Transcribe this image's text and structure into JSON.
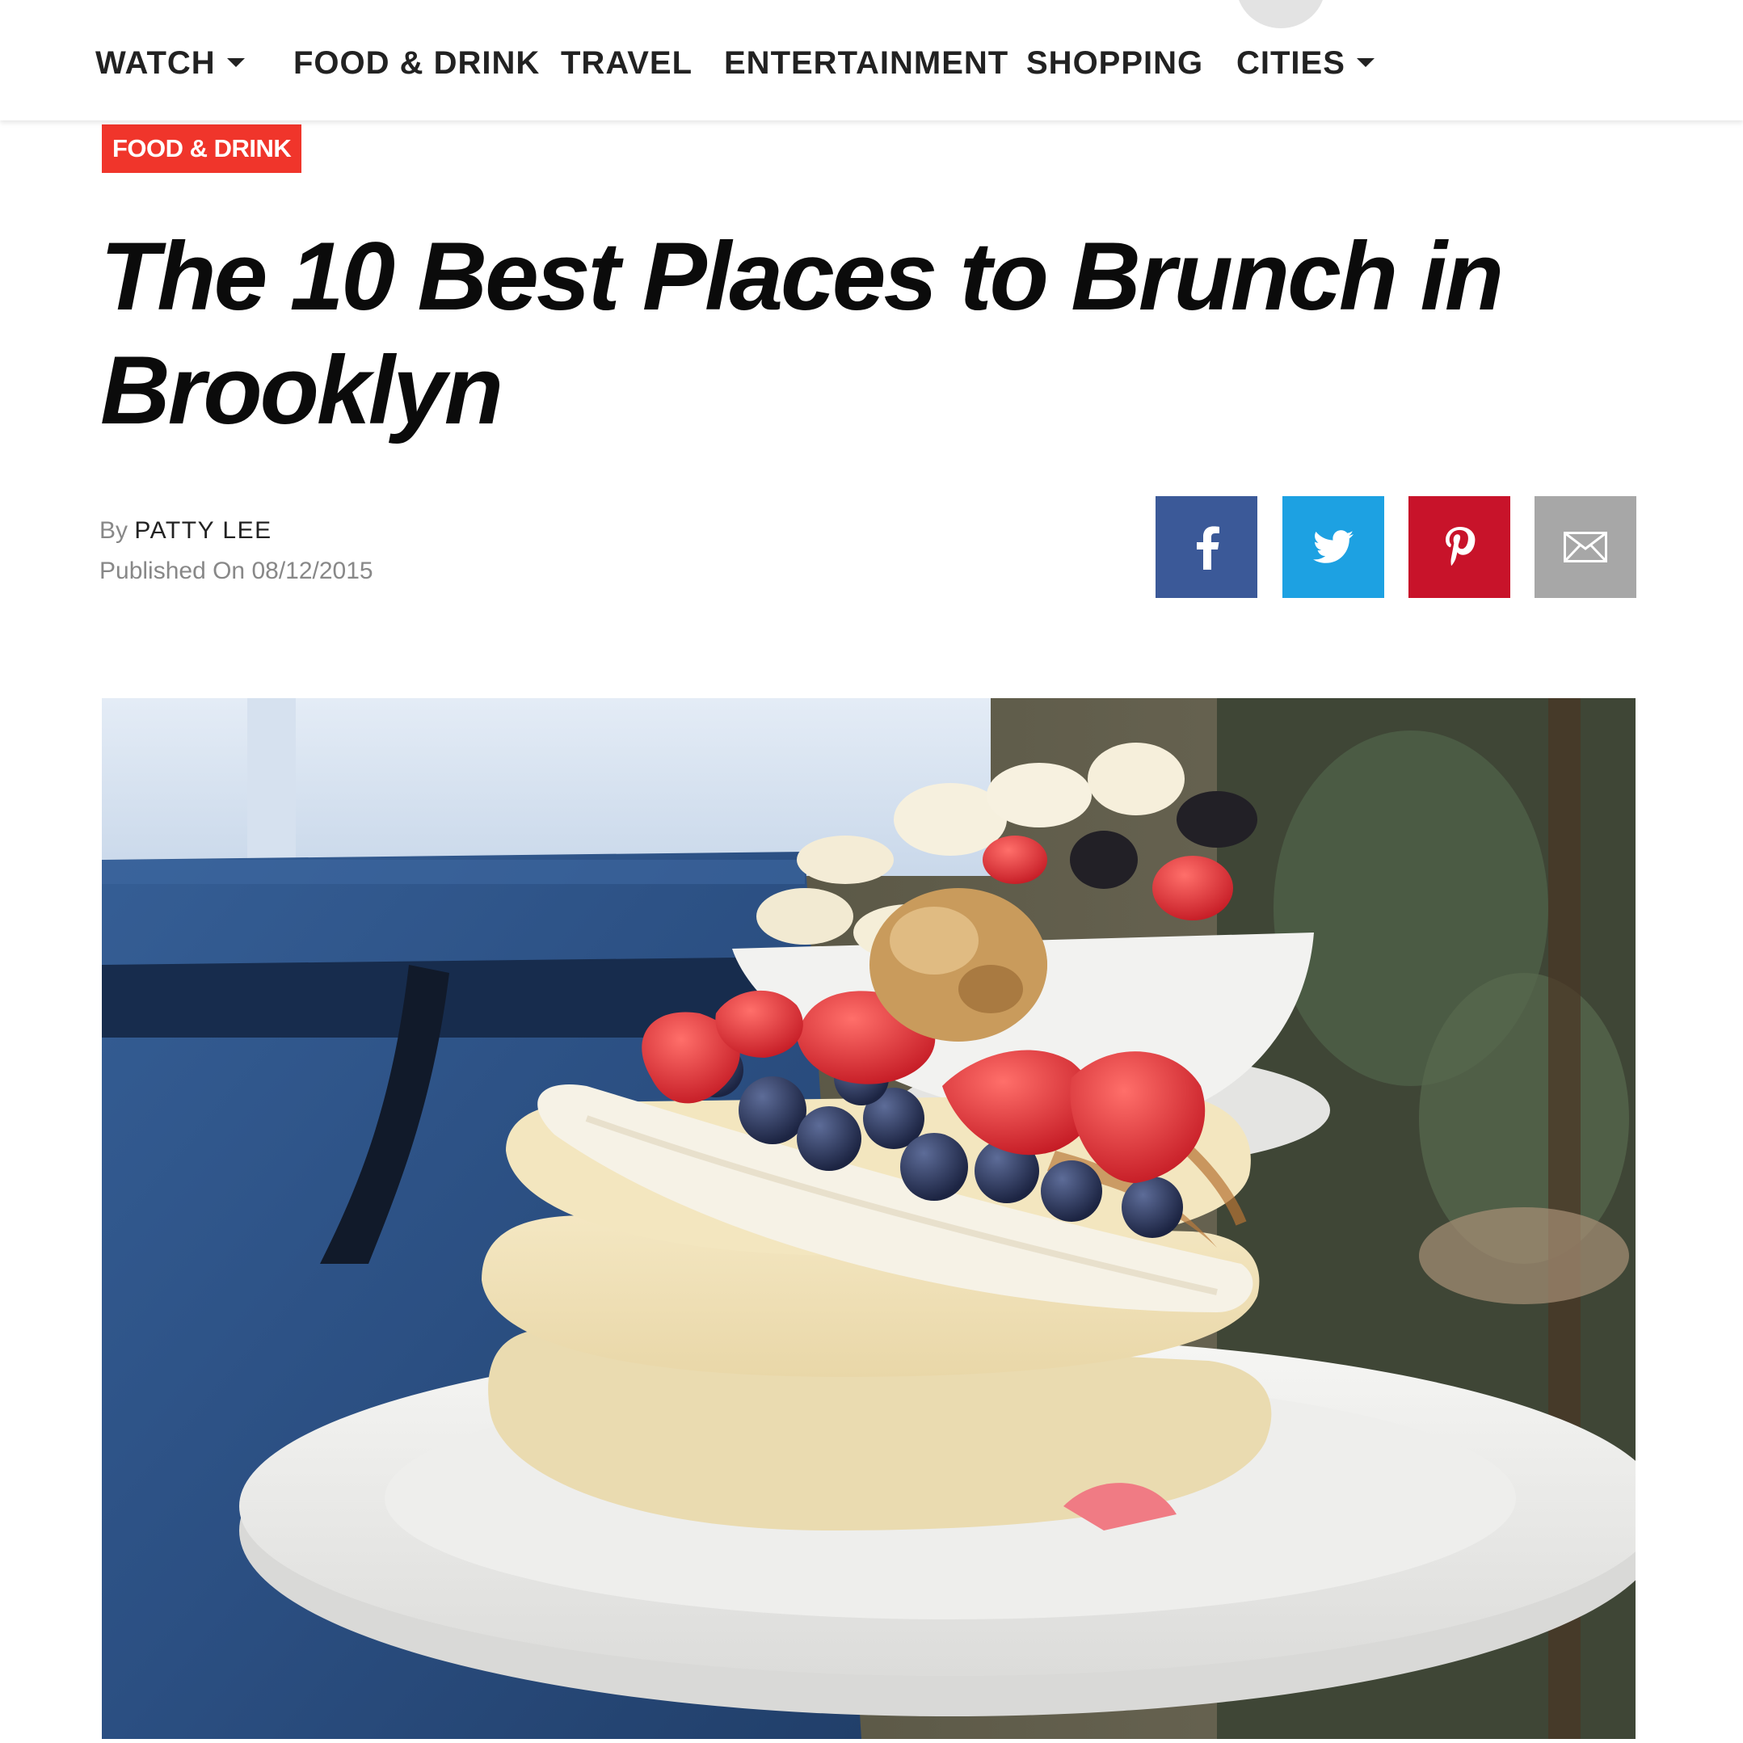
{
  "nav": {
    "items": [
      {
        "label": "WATCH",
        "dropdown": true
      },
      {
        "label": "FOOD & DRINK",
        "dropdown": false
      },
      {
        "label": "TRAVEL",
        "dropdown": false
      },
      {
        "label": "ENTERTAINMENT",
        "dropdown": false
      },
      {
        "label": "SHOPPING",
        "dropdown": false
      },
      {
        "label": "CITIES",
        "dropdown": true
      }
    ]
  },
  "article": {
    "category": "FOOD & DRINK",
    "title": "The 10 Best Places to Brunch in Brooklyn",
    "by_prefix": "By",
    "author": "PATTY LEE",
    "published": "Published On 08/12/2015"
  },
  "share": [
    {
      "network": "facebook",
      "icon": "facebook-icon",
      "color": "#3b5998"
    },
    {
      "network": "twitter",
      "icon": "twitter-icon",
      "color": "#1da1e2"
    },
    {
      "network": "pinterest",
      "icon": "pinterest-icon",
      "color": "#c8132a"
    },
    {
      "network": "email",
      "icon": "email-icon",
      "color": "#a7a7a7"
    }
  ],
  "colors": {
    "accent": "#f0352b",
    "text": "#0b0b0b",
    "muted": "#888888"
  },
  "hero": {
    "image": "photo of a pancake stack topped with banana, strawberries and blueberries held by a server, fruit bowl behind"
  }
}
